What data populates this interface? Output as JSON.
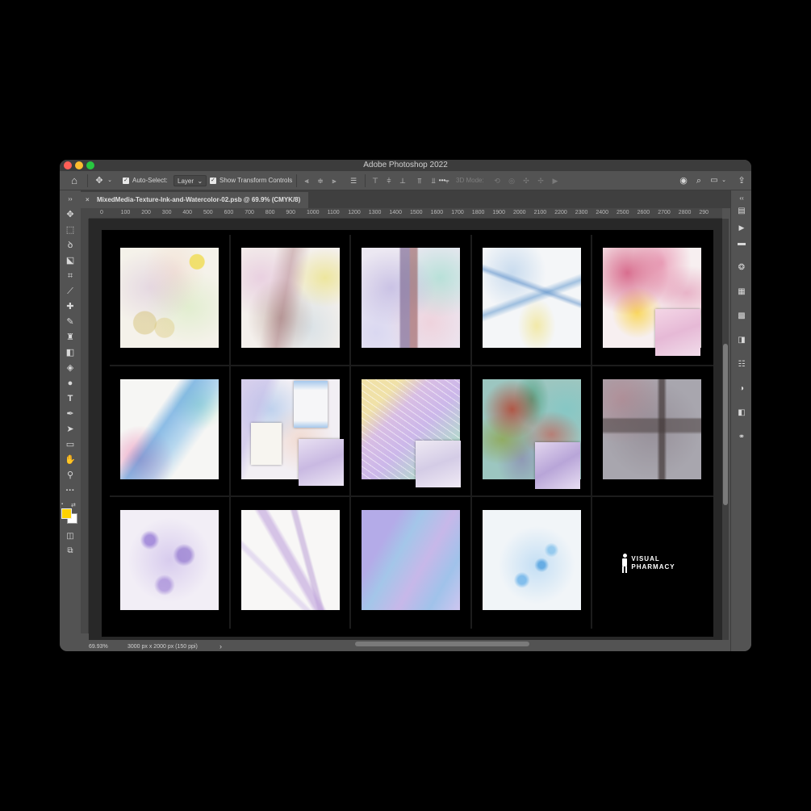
{
  "app": {
    "title": "Adobe Photoshop 2022"
  },
  "options_bar": {
    "auto_select_label": "Auto-Select:",
    "auto_select_checked": true,
    "layer_select_value": "Layer",
    "show_transform_label": "Show Transform Controls",
    "show_transform_checked": true,
    "three_d_mode_label": "3D Mode:",
    "more_label": "•••"
  },
  "document_tab": {
    "title": "MixedMedia-Texture-Ink-and-Watercolor-02.psb @ 69.9% (CMYK/8)",
    "close_glyph": "×"
  },
  "ruler": {
    "labels": [
      "0",
      "100",
      "200",
      "300",
      "400",
      "500",
      "600",
      "700",
      "800",
      "900",
      "1000",
      "1100",
      "1200",
      "1300",
      "1400",
      "1500",
      "1600",
      "1700",
      "1800",
      "1900",
      "2000",
      "2100",
      "2200",
      "2300",
      "2400",
      "2500",
      "2600",
      "2700",
      "2800",
      "290"
    ]
  },
  "artwork": {
    "logo_line1": "VISUAL",
    "logo_line2": "PHARMACY"
  },
  "status_bar": {
    "zoom": "69.93%",
    "doc_info": "3000 px x 2000 px (150 ppi)",
    "arrow": "›"
  },
  "colors": {
    "foreground": "#ffd200",
    "background": "#ffffff",
    "ui_panel": "#535353",
    "ui_dark": "#3c3c3c"
  },
  "tools": [
    "move-tool",
    "marquee-tool",
    "lasso-tool",
    "object-select-tool",
    "crop-tool",
    "eyedropper-tool",
    "brush-tool",
    "clone-stamp-tool",
    "eraser-tool",
    "paint-bucket-tool",
    "pen-tool",
    "type-tool",
    "path-select-tool",
    "rectangle-tool",
    "hand-tool",
    "zoom-tool",
    "more-tools"
  ]
}
